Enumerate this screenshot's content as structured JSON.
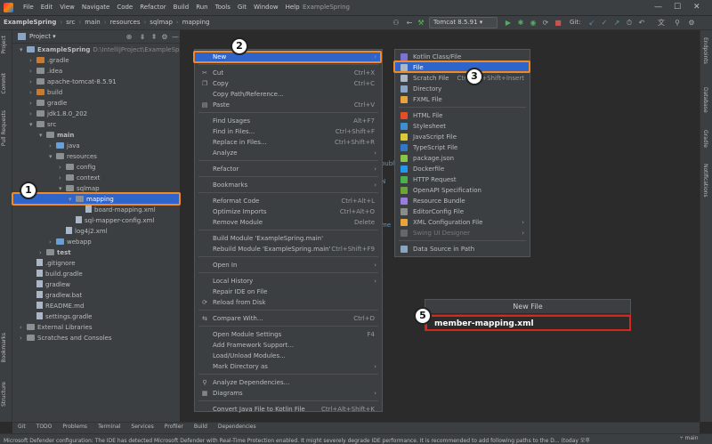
{
  "menu_bar": [
    "File",
    "Edit",
    "View",
    "Navigate",
    "Code",
    "Refactor",
    "Build",
    "Run",
    "Tools",
    "Git",
    "Window",
    "Help"
  ],
  "window_title": "ExampleSpring",
  "breadcrumbs": [
    "ExampleSpring",
    "src",
    "main",
    "resources",
    "sqlmap",
    "mapping"
  ],
  "run_config": "Tomcat 8.5.91",
  "git_label": "Git:",
  "left_tabs": [
    "Project",
    "Commit",
    "Pull Requests",
    "Bookmarks",
    "Structure"
  ],
  "right_tabs": [
    "Endpoints",
    "Database",
    "Gradle",
    "Notifications"
  ],
  "project_header": "Project",
  "tree": [
    {
      "label": "ExampleSpring",
      "extra": "D:\\IntelliJProject\\ExampleSpring",
      "indent": 0,
      "arrow": "▾",
      "icon": "fold",
      "bold": true
    },
    {
      "label": ".gradle",
      "indent": 1,
      "arrow": "›",
      "icon": "fold or"
    },
    {
      "label": ".idea",
      "indent": 1,
      "arrow": "›",
      "icon": "fold gr"
    },
    {
      "label": "apache-tomcat-8.5.91",
      "indent": 1,
      "arrow": "›",
      "icon": "fold gr"
    },
    {
      "label": "build",
      "indent": 1,
      "arrow": "›",
      "icon": "fold or"
    },
    {
      "label": "gradle",
      "indent": 1,
      "arrow": "›",
      "icon": "fold gr"
    },
    {
      "label": "jdk1.8.0_202",
      "indent": 1,
      "arrow": "›",
      "icon": "fold gr"
    },
    {
      "label": "src",
      "indent": 1,
      "arrow": "▾",
      "icon": "fold gr"
    },
    {
      "label": "main",
      "indent": 2,
      "arrow": "▾",
      "icon": "fold gr",
      "bold": true
    },
    {
      "label": "java",
      "indent": 3,
      "arrow": "›",
      "icon": "fold bl"
    },
    {
      "label": "resources",
      "indent": 3,
      "arrow": "▾",
      "icon": "fold gr"
    },
    {
      "label": "config",
      "indent": 4,
      "arrow": "›",
      "icon": "fold gr"
    },
    {
      "label": "context",
      "indent": 4,
      "arrow": "›",
      "icon": "fold gr"
    },
    {
      "label": "sqlmap",
      "indent": 4,
      "arrow": "▾",
      "icon": "fold gr"
    },
    {
      "label": "mapping",
      "indent": 5,
      "arrow": "▾",
      "icon": "fold gr",
      "selected": true
    },
    {
      "label": "board-mapping.xml",
      "indent": 6,
      "arrow": "",
      "icon": "fi"
    },
    {
      "label": "sql-mapper-config.xml",
      "indent": 5,
      "arrow": "",
      "icon": "fi"
    },
    {
      "label": "log4j2.xml",
      "indent": 4,
      "arrow": "",
      "icon": "fi"
    },
    {
      "label": "webapp",
      "indent": 3,
      "arrow": "›",
      "icon": "fold bl"
    },
    {
      "label": "test",
      "indent": 2,
      "arrow": "›",
      "icon": "fold gr",
      "bold": true
    },
    {
      "label": ".gitignore",
      "indent": 1,
      "arrow": "",
      "icon": "fi"
    },
    {
      "label": "build.gradle",
      "indent": 1,
      "arrow": "",
      "icon": "fi"
    },
    {
      "label": "gradlew",
      "indent": 1,
      "arrow": "",
      "icon": "fi"
    },
    {
      "label": "gradlew.bat",
      "indent": 1,
      "arrow": "",
      "icon": "fi"
    },
    {
      "label": "README.md",
      "indent": 1,
      "arrow": "",
      "icon": "fi"
    },
    {
      "label": "settings.gradle",
      "indent": 1,
      "arrow": "",
      "icon": "fi"
    },
    {
      "label": "External Libraries",
      "indent": 0,
      "arrow": "›",
      "icon": "fold gr"
    },
    {
      "label": "Scratches and Consoles",
      "indent": 0,
      "arrow": "›",
      "icon": "fold gr"
    }
  ],
  "context_menu": [
    {
      "label": "New",
      "sub": true,
      "hl": true
    },
    {
      "sep": true
    },
    {
      "label": "Cut",
      "sc": "Ctrl+X",
      "ic": "✂"
    },
    {
      "label": "Copy",
      "sc": "Ctrl+C",
      "ic": "❐"
    },
    {
      "label": "Copy Path/Reference..."
    },
    {
      "label": "Paste",
      "sc": "Ctrl+V",
      "ic": "▤"
    },
    {
      "sep": true
    },
    {
      "label": "Find Usages",
      "sc": "Alt+F7"
    },
    {
      "label": "Find in Files...",
      "sc": "Ctrl+Shift+F"
    },
    {
      "label": "Replace in Files...",
      "sc": "Ctrl+Shift+R"
    },
    {
      "label": "Analyze",
      "sub": true
    },
    {
      "sep": true
    },
    {
      "label": "Refactor",
      "sub": true
    },
    {
      "sep": true
    },
    {
      "label": "Bookmarks",
      "sub": true
    },
    {
      "sep": true
    },
    {
      "label": "Reformat Code",
      "sc": "Ctrl+Alt+L"
    },
    {
      "label": "Optimize Imports",
      "sc": "Ctrl+Alt+O"
    },
    {
      "label": "Remove Module",
      "sc": "Delete"
    },
    {
      "sep": true
    },
    {
      "label": "Build Module 'ExampleSpring.main'"
    },
    {
      "label": "Rebuild Module 'ExampleSpring.main'",
      "sc": "Ctrl+Shift+F9"
    },
    {
      "sep": true
    },
    {
      "label": "Open In",
      "sub": true
    },
    {
      "sep": true
    },
    {
      "label": "Local History",
      "sub": true
    },
    {
      "label": "Repair IDE on File"
    },
    {
      "label": "Reload from Disk",
      "ic": "⟳"
    },
    {
      "sep": true
    },
    {
      "label": "Compare With...",
      "sc": "Ctrl+D",
      "ic": "⇆"
    },
    {
      "sep": true
    },
    {
      "label": "Open Module Settings",
      "sc": "F4"
    },
    {
      "label": "Add Framework Support..."
    },
    {
      "label": "Load/Unload Modules..."
    },
    {
      "label": "Mark Directory as",
      "sub": true
    },
    {
      "sep": true
    },
    {
      "label": "Analyze Dependencies...",
      "ic": "⚲"
    },
    {
      "label": "Diagrams",
      "sub": true,
      "ic": "▦"
    },
    {
      "sep": true
    },
    {
      "label": "Convert Java File to Kotlin File",
      "sc": "Ctrl+Alt+Shift+K"
    }
  ],
  "new_submenu": [
    {
      "label": "Kotlin Class/File",
      "color": "#7f6fd6"
    },
    {
      "label": "File",
      "color": "#a9b7c6",
      "hl": true
    },
    {
      "label": "Scratch File",
      "sc": "Ctrl+Alt+Shift+Insert",
      "color": "#a9b7c6"
    },
    {
      "label": "Directory",
      "color": "#8aa4c1"
    },
    {
      "label": "FXML File",
      "color": "#e8a33d"
    },
    {
      "sep": true
    },
    {
      "label": "HTML File",
      "color": "#e44d26"
    },
    {
      "label": "Stylesheet",
      "color": "#3d8fd1"
    },
    {
      "label": "JavaScript File",
      "color": "#d9c83a"
    },
    {
      "label": "TypeScript File",
      "color": "#3178c6"
    },
    {
      "label": "package.json",
      "color": "#8bc34a"
    },
    {
      "label": "Dockerfile",
      "color": "#2496ed"
    },
    {
      "label": "HTTP Request",
      "color": "#4caf50"
    },
    {
      "label": "OpenAPI Specification",
      "color": "#6ba539"
    },
    {
      "label": "Resource Bundle",
      "color": "#9c7be0"
    },
    {
      "label": "EditorConfig File",
      "color": "#8c8c8c"
    },
    {
      "label": "XML Configuration File",
      "sub": true,
      "color": "#e8a33d"
    },
    {
      "label": "Swing UI Designer",
      "sub": true,
      "dis": true,
      "color": "#666"
    },
    {
      "sep": true
    },
    {
      "label": "Data Source in Path",
      "color": "#8aa4c1"
    }
  ],
  "callouts": [
    "1",
    "2",
    "3",
    "5"
  ],
  "editor_hints": [
    "ouble",
    "N",
    "me",
    "n th"
  ],
  "new_file_dialog": {
    "title": "New File",
    "value": "member-mapping.xml"
  },
  "bottom_tabs": [
    "Git",
    "TODO",
    "Problems",
    "Terminal",
    "Services",
    "Profiler",
    "Build",
    "Dependencies"
  ],
  "status_text": "Microsoft Defender configuration: The IDE has detected Microsoft Defender with Real-Time Protection enabled. It might severely degrade IDE performance. It is recommended to add following paths to the D... (today 오후",
  "status_branch": "main"
}
